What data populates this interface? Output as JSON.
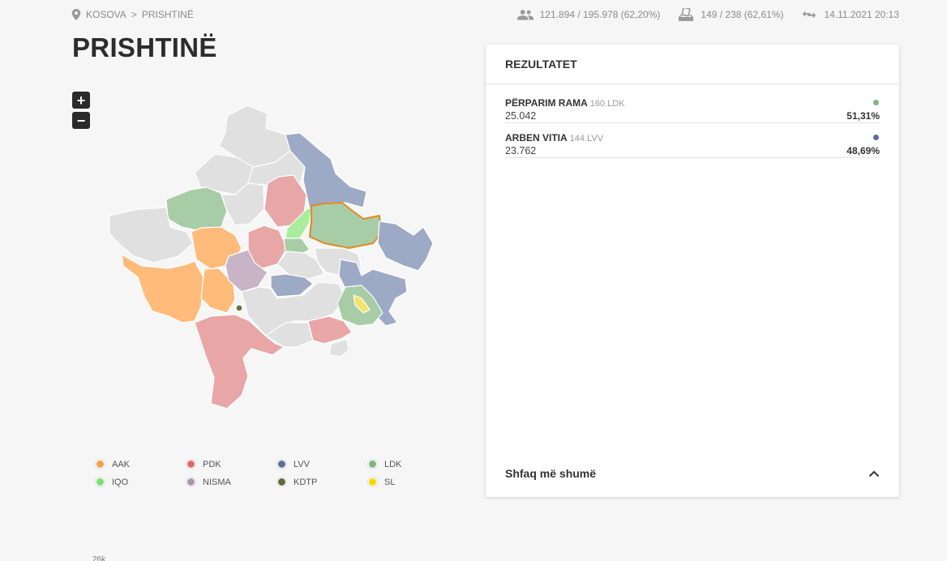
{
  "breadcrumb": {
    "country": "KOSOVA",
    "separator": ">",
    "municipality": "PRISHTINË"
  },
  "stats": {
    "voters": "121.894 / 195.978 (62,20%)",
    "stations": "149 / 238 (62,61%)",
    "updated": "14.11.2021 20:13"
  },
  "title": "PRISHTINË",
  "zoom": {
    "in": "+",
    "out": "−"
  },
  "legend": [
    {
      "label": "AAK",
      "color": "#f4a14a"
    },
    {
      "label": "PDK",
      "color": "#e06a6a"
    },
    {
      "label": "LVV",
      "color": "#5a6e9b"
    },
    {
      "label": "LDK",
      "color": "#7eb57c"
    },
    {
      "label": "IQO",
      "color": "#7be073"
    },
    {
      "label": "NISMA",
      "color": "#a994aa"
    },
    {
      "label": "KDTP",
      "color": "#5d6b3a"
    },
    {
      "label": "SL",
      "color": "#f5d800"
    }
  ],
  "results": {
    "header": "REZULTATET",
    "candidates": [
      {
        "name": "PËRPARIM RAMA",
        "party": "160.LDK",
        "votes": "25.042",
        "percent": "51,31%",
        "color": "#7eb57c"
      },
      {
        "name": "ARBEN VITIA",
        "party": "144.LVV",
        "votes": "23.762",
        "percent": "48,69%",
        "color": "#5a6e9b"
      }
    ],
    "show_more": "Shfaq më shumë"
  },
  "footer_stub": "26k",
  "colors": {
    "region_default": "#e0e0e0",
    "region_aak": "#ffbb7a",
    "region_pdk": "#e9a6a6",
    "region_lvv": "#9caac6",
    "region_ldk": "#a8cda6",
    "region_iqo": "#a9ec9c",
    "region_nisma": "#c8b3c7",
    "region_sl": "#f3e36a",
    "selected_outline": "#e08a24"
  }
}
